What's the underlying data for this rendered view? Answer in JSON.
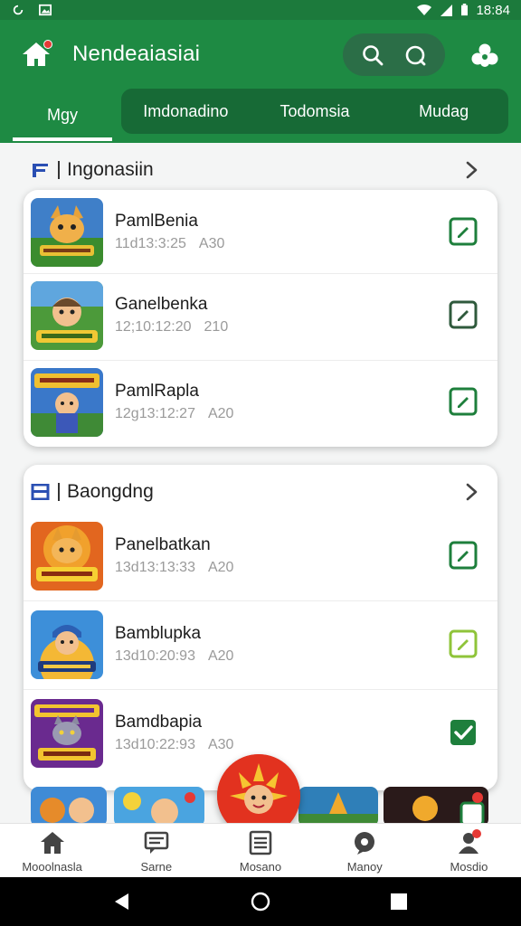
{
  "status_bar": {
    "time": "18:84",
    "left_icons": [
      "sync-icon",
      "image-icon"
    ],
    "right_icons": [
      "wifi-icon",
      "signal-icon",
      "battery-icon"
    ]
  },
  "header": {
    "title": "Nendeaiasiai",
    "icons": [
      "home-icon",
      "search-icon",
      "profile-icon",
      "extension-icon"
    ],
    "colors": {
      "header_bg": "#1e8a43",
      "pill_bg": "#2b6e47",
      "accent_red": "#e53935"
    }
  },
  "tabs": {
    "active": "Mgy",
    "items": [
      "Imdonadino",
      "Todomsia",
      "Mudag"
    ]
  },
  "sections": [
    {
      "title": "Ingonasiin",
      "items": [
        {
          "name": "PamlBenia",
          "date": "11d13:3:25",
          "size": "A30",
          "thumb": "game-fox-icon",
          "checked": false
        },
        {
          "name": "Ganelbenka",
          "date": "12;10:12:20",
          "size": "210",
          "thumb": "game-boy-icon",
          "checked": false
        },
        {
          "name": "PamlRapla",
          "date": "12g13:12:27",
          "size": "A20",
          "thumb": "game-hero-icon",
          "checked": false
        }
      ]
    },
    {
      "title": "Baongdng",
      "items": [
        {
          "name": "Panelbatkan",
          "date": "13d13:13:33",
          "size": "A20",
          "thumb": "game-fox2-icon",
          "checked": false
        },
        {
          "name": "Bamblupka",
          "date": "13d10:20:93",
          "size": "A20",
          "thumb": "game-boy2-icon",
          "checked": false
        },
        {
          "name": "Bamdbapia",
          "date": "13d10:22:93",
          "size": "A30",
          "thumb": "game-cat-icon",
          "checked": true
        }
      ]
    }
  ],
  "bottom_nav": [
    {
      "label": "Mooolnasla",
      "icon": "home-icon"
    },
    {
      "label": "Sarne",
      "icon": "chat-icon"
    },
    {
      "label": "Mosano",
      "icon": "list-icon"
    },
    {
      "label": "Manoy",
      "icon": "globe-icon"
    },
    {
      "label": "Mosdio",
      "icon": "profile-icon"
    }
  ],
  "system_nav": [
    "back-icon",
    "home-circle-icon",
    "recents-icon"
  ]
}
